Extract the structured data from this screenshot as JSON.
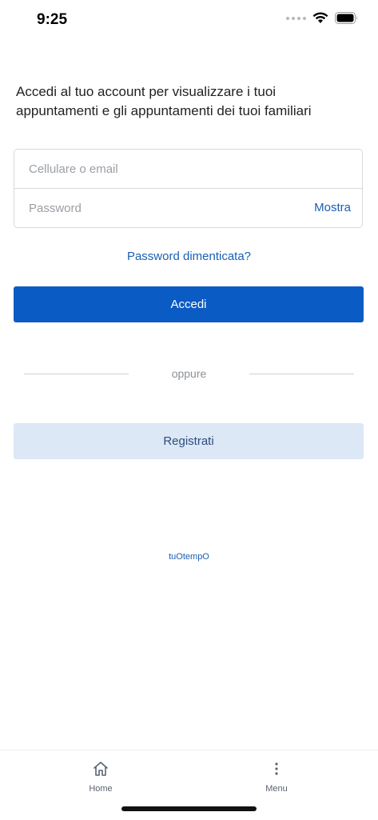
{
  "status_bar": {
    "time": "9:25"
  },
  "intro_text": "Accedi al tuo account per visualizzare i tuoi appuntamenti e gli appuntamenti dei tuoi familiari",
  "login_form": {
    "email_placeholder": "Cellulare o email",
    "password_placeholder": "Password",
    "show_label": "Mostra"
  },
  "forgot_password": "Password dimenticata?",
  "login_button": "Accedi",
  "divider_text": "oppure",
  "register_button": "Registrati",
  "brand": "tuOtempO",
  "tab_bar": {
    "items": [
      {
        "label": "Home",
        "icon": "home-icon"
      },
      {
        "label": "Menu",
        "icon": "more-vertical-icon"
      }
    ]
  },
  "colors": {
    "accent": "#0a5bc4",
    "link": "#1a5fb4",
    "register_bg": "#dce8f6"
  }
}
